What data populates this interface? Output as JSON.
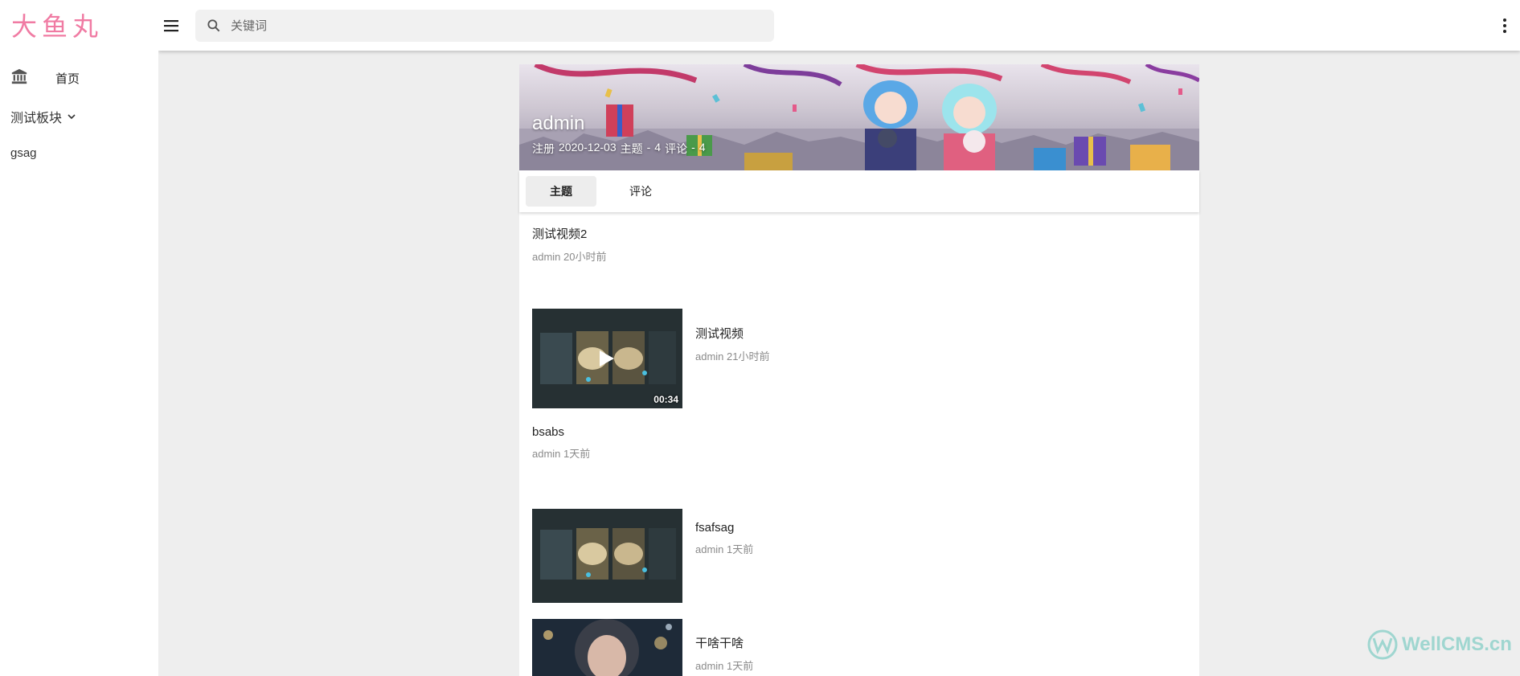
{
  "sidebar": {
    "logo": "大鱼丸",
    "home_label": "首页",
    "section_label": "测试板块",
    "sub_item": "gsag"
  },
  "header": {
    "search_placeholder": "关键词"
  },
  "profile": {
    "name": "admin",
    "registered_label": "注册",
    "registered_date": "2020-12-03",
    "topics_label": "主题",
    "topics_count": "4",
    "comments_label": "评论",
    "comments_count": "4",
    "separator": "-"
  },
  "tabs": [
    {
      "label": "主题",
      "active": true
    },
    {
      "label": "评论",
      "active": false
    }
  ],
  "threads": [
    {
      "title": "测试视频2",
      "author": "admin",
      "time": "20小时前"
    },
    {
      "title": "测试视频",
      "author": "admin",
      "time": "21小时前",
      "duration": "00:34"
    },
    {
      "title": "bsabs",
      "author": "admin",
      "time": "1天前"
    },
    {
      "title": "fsafsag",
      "author": "admin",
      "time": "1天前"
    },
    {
      "title": "干啥干啥",
      "author": "admin",
      "time": "1天前"
    }
  ],
  "watermark": "WellCMS.cn",
  "colors": {
    "logo": "#f07ba3",
    "page_bg": "#eeeeee",
    "meta_text": "#8a8a8a",
    "watermark": "#9fd6d0"
  }
}
